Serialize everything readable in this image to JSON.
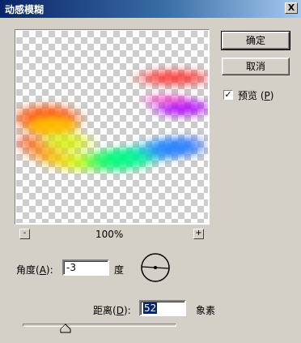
{
  "window": {
    "title": "动感模糊",
    "close_label": "X"
  },
  "buttons": {
    "ok": "确定",
    "cancel": "取消"
  },
  "preview_option": {
    "checked": true,
    "check_mark": "✓",
    "label_prefix": "预览 (",
    "label_key": "P",
    "label_suffix": ")"
  },
  "zoom": {
    "minus": "-",
    "plus": "+",
    "value": "100%"
  },
  "angle": {
    "label_prefix": "角度(",
    "label_key": "A",
    "label_suffix": "):",
    "value": "-3",
    "unit": "度"
  },
  "distance": {
    "label_prefix": "距离(",
    "label_key": "D",
    "label_suffix": "):",
    "value": "52",
    "unit": "象素",
    "slider_fraction": 0.28
  },
  "icons": {
    "close": "close-icon",
    "dial": "angle-dial-icon",
    "thumb": "slider-thumb-icon"
  }
}
